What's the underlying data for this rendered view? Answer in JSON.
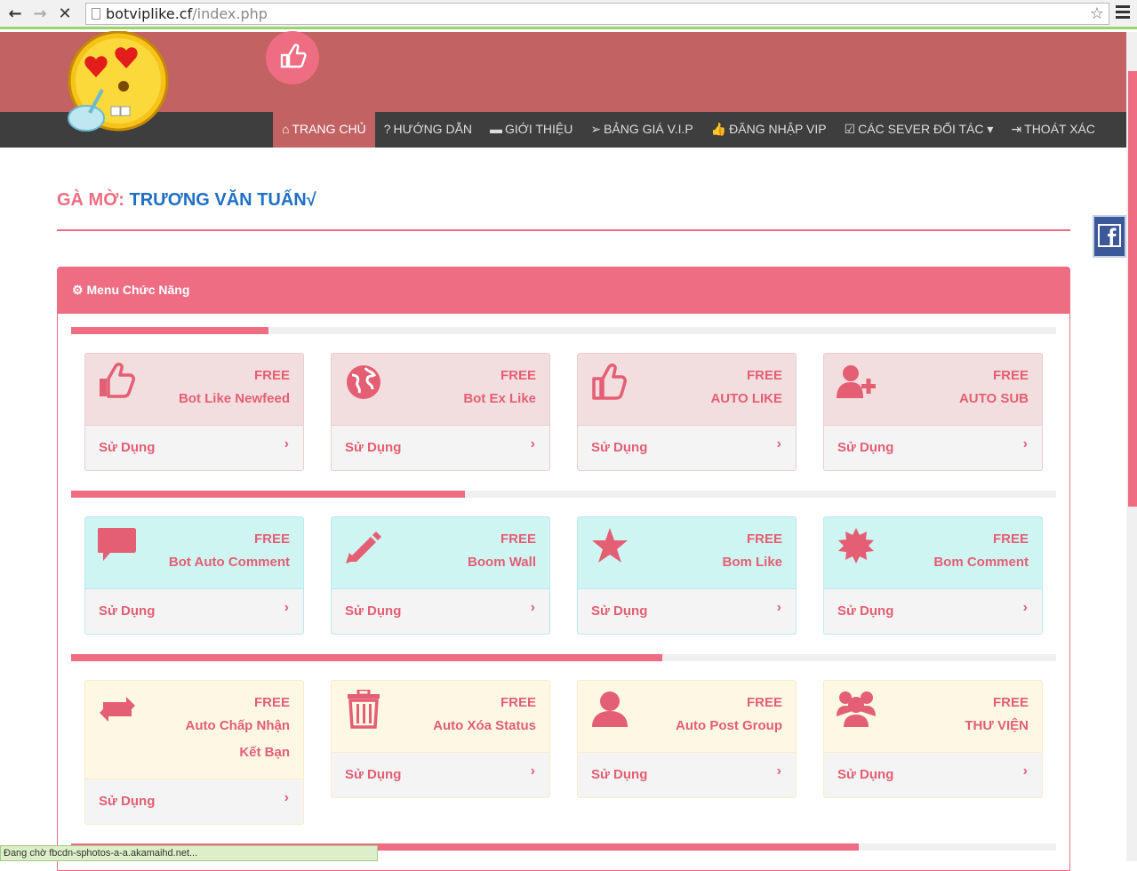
{
  "browser": {
    "url_domain": "botviplike.cf",
    "url_path": "/index.php"
  },
  "nav": [
    {
      "label": "TRANG CHỦ",
      "icon": "home-icon",
      "active": true
    },
    {
      "label": "HƯỚNG DẪN",
      "icon": "question-icon"
    },
    {
      "label": "GIỚI THIỆU",
      "icon": "briefcase-icon"
    },
    {
      "label": "BẢNG GIÁ V.I.P",
      "icon": "paper-plane-icon"
    },
    {
      "label": "ĐĂNG NHẬP VIP",
      "icon": "thumbs-up-icon"
    },
    {
      "label": "CÁC SEVER ĐỐI TÁC",
      "icon": "check-square-icon",
      "dropdown": true
    },
    {
      "label": "THOÁT XÁC",
      "icon": "sign-out-icon"
    }
  ],
  "owner": {
    "label": "GÀ MỜ:",
    "name": "TRƯƠNG VĂN TUẤN√"
  },
  "panel_title": "Menu Chức Năng",
  "progress": [
    20,
    40,
    60,
    80
  ],
  "cards": [
    {
      "badge": "FREE",
      "title": "Bot Like Newfeed",
      "action": "Sử Dụng",
      "icon": "thumbs-up-icon",
      "theme": "pink"
    },
    {
      "badge": "FREE",
      "title": "Bot Ex Like",
      "action": "Sử Dụng",
      "icon": "globe-icon",
      "theme": "pink"
    },
    {
      "badge": "FREE",
      "title": "AUTO LIKE",
      "action": "Sử Dụng",
      "icon": "thumbs-up-outline-icon",
      "theme": "pink"
    },
    {
      "badge": "FREE",
      "title": "AUTO SUB",
      "action": "Sử Dụng",
      "icon": "user-plus-icon",
      "theme": "pink"
    },
    {
      "badge": "FREE",
      "title": "Bot Auto Comment",
      "action": "Sử Dụng",
      "icon": "comment-icon",
      "theme": "cyan"
    },
    {
      "badge": "FREE",
      "title": "Boom Wall",
      "action": "Sử Dụng",
      "icon": "pencil-icon",
      "theme": "cyan"
    },
    {
      "badge": "FREE",
      "title": "Bom Like",
      "action": "Sử Dụng",
      "icon": "star-icon",
      "theme": "cyan"
    },
    {
      "badge": "FREE",
      "title": "Bom Comment",
      "action": "Sử Dụng",
      "icon": "certificate-icon",
      "theme": "cyan"
    },
    {
      "badge": "FREE",
      "title": "Auto Chấp Nhận Kết Bạn",
      "action": "Sử Dụng",
      "icon": "retweet-icon",
      "theme": "cream"
    },
    {
      "badge": "FREE",
      "title": "Auto Xóa Status",
      "action": "Sử Dụng",
      "icon": "trash-icon",
      "theme": "cream"
    },
    {
      "badge": "FREE",
      "title": "Auto Post Group",
      "action": "Sử Dụng",
      "icon": "user-icon",
      "theme": "cream"
    },
    {
      "badge": "FREE",
      "title": "THƯ VIỆN",
      "action": "Sử Dụng",
      "icon": "users-icon",
      "theme": "cream"
    }
  ],
  "colors": {
    "accent": "#ee6d82",
    "header": "#c26262",
    "navbar": "#3e3e3e",
    "owner_name": "#1f6fc5"
  },
  "status_text": "Đang chờ fbcdn-sphotos-a-a.akamaihd.net..."
}
